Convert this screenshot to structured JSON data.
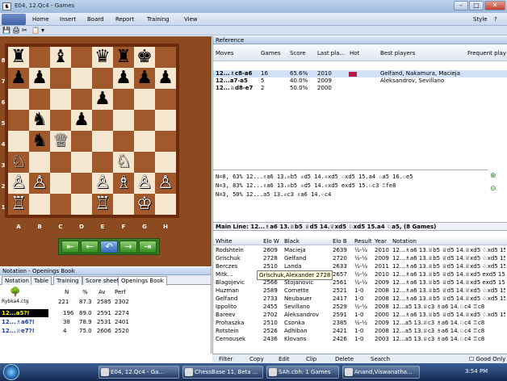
{
  "window": {
    "title": "E04, 12.Qc4 - Games",
    "controls": [
      "–",
      "□",
      "✕"
    ]
  },
  "menu": {
    "items": [
      "Home",
      "Insert",
      "Board",
      "Report",
      "Training",
      "View"
    ],
    "style": "Style"
  },
  "quick_access": [
    "💾",
    "🖨",
    "✂",
    "📋",
    "▾"
  ],
  "board": {
    "ranks": [
      "8",
      "7",
      "6",
      "5",
      "4",
      "3",
      "2",
      "1"
    ],
    "files": [
      "A",
      "B",
      "C",
      "D",
      "E",
      "F",
      "G",
      "H"
    ],
    "position": [
      [
        "♜",
        "",
        "♝",
        "",
        "♛",
        "♜",
        "♚",
        ""
      ],
      [
        "♟",
        "♟",
        "",
        "",
        "",
        "♟",
        "♟",
        "♟"
      ],
      [
        "",
        "",
        "",
        "",
        "♟",
        "",
        "",
        ""
      ],
      [
        "",
        "♞",
        "",
        "♟",
        "",
        "",
        "",
        ""
      ],
      [
        "",
        "♞",
        "♕",
        "",
        "",
        "",
        "",
        ""
      ],
      [
        "♘",
        "",
        "",
        "",
        "",
        "♘",
        "",
        ""
      ],
      [
        "♙",
        "♙",
        "",
        "",
        "♙",
        "♗",
        "♙",
        "♙"
      ],
      [
        "♖",
        "",
        "",
        "",
        "♖",
        "",
        "♔",
        ""
      ]
    ],
    "white_pieces": [
      "♔",
      "♕",
      "♖",
      "♗",
      "♘",
      "♙"
    ],
    "nav": [
      "⇤",
      "←",
      "↶",
      "→",
      "⇥"
    ]
  },
  "notation": {
    "header": "Notation - Openings Book",
    "tabs": [
      "Notation",
      "Table",
      "Training",
      "Score sheet",
      "Openings Book"
    ],
    "book_name": "Rybka4.ctg",
    "cols": [
      "N",
      "%",
      "Av",
      "Perf"
    ],
    "summary": [
      "221",
      "87.3",
      "2585",
      "2302"
    ],
    "moves": [
      {
        "move": "12...a5?!",
        "n": "196",
        "pct": "89.0",
        "av": "2591",
        "perf": "2274"
      },
      {
        "move": "12...♗a6?!",
        "n": "38",
        "pct": "78.9",
        "av": "2531",
        "perf": "2401"
      },
      {
        "move": "12...♕e7?!",
        "n": "4",
        "pct": "75.0",
        "av": "2606",
        "perf": "2520"
      }
    ]
  },
  "reference": {
    "header": "Reference",
    "cols": [
      "Moves",
      "Games",
      "Score",
      "Last pla...",
      "Hot",
      "Best players",
      "Frequent play"
    ],
    "rows": [
      {
        "move": "12...♗c8-a6",
        "games": "16",
        "score": "65.6%",
        "last": "2010",
        "best": "Gelfand, Nakamura, Macieja"
      },
      {
        "move": "12...a7-a5",
        "games": "5",
        "score": "40.0%",
        "last": "2009",
        "best": "Aleksandrov, Sevillano"
      },
      {
        "move": "12...♕d8-e7",
        "games": "2",
        "score": "50.0%",
        "last": "2000",
        "best": ""
      }
    ]
  },
  "engine": {
    "lines": [
      "N=8, 63%  12...♗a6 13.♕b5 ♕d5 14.♕xd5 ♘xd5 15.a4 ♘a5 16.♘e5",
      "N=3, 83%  12...♗a6 13.♕b5 ♕d5 14.♕xd5 exd5 15.♘c3 ♖fe8",
      "N=3, 50%  12...a5 13.♕c3 ♗a6 14.♘c4"
    ],
    "mainline": "Main Line: 12...♗a6 13.♕b5 ♕d5 14.♕xd5 ♘xd5 15.a4 ♘a5, (8 Games)"
  },
  "games": {
    "cols": [
      "White",
      "Elo W",
      "Black",
      "Elo B",
      "Result",
      "Year",
      "Notation"
    ],
    "rows": [
      [
        "Rodshtein",
        "2609",
        "Macieja",
        "2639",
        "½-½",
        "2010",
        "12...♗a6 13.♕b5 ♕d5 14.♕xd5 ♘xd5 15.a4 ♘a5"
      ],
      [
        "Grischuk",
        "2728",
        "Gelfand",
        "2720",
        "½-½",
        "2009",
        "12...♗a6 13.♕b5 ♕d5 14.♕xd5 ♘xd5 15.a4 ♘a5"
      ],
      [
        "Berczes",
        "2510",
        "Landa",
        "2633",
        "½-½",
        "2011",
        "12...♗a6 13.♕b5 ♕d5 14.♕xd5 ♘xd5 15.a4 ♘a5"
      ],
      [
        "Mitk...",
        "",
        "...amura",
        "2657",
        "½-½",
        "2010",
        "12...♗a6 13.♕b5 ♕d5 14.♕xd5 exd5 15.♘c3 ♖fe8"
      ],
      [
        "Blagojevic",
        "2566",
        "Stojanovic",
        "2561",
        "½-½",
        "2009",
        "12...♗a6 13.♕b5 ♕d5 14.♕xd5 exd5 15.♘c3 ♖fe8"
      ],
      [
        "Huzman",
        "2589",
        "Cornette",
        "2521",
        "1-0",
        "2008",
        "12...♗a6 13.♕b5 ♕d5 14.♕xd5 ♘xd5 15.a4 ♘a5"
      ],
      [
        "Gelfand",
        "2733",
        "Neubauer",
        "2417",
        "1-0",
        "2008",
        "12...♗a6 13.♕b5 ♕d5 14.♕xd5 ♘xd5 15.a4 ♘a5"
      ],
      [
        "Ippolito",
        "2455",
        "Sevillano",
        "2529",
        "½-½",
        "2008",
        "12...a5 13.♕c3 ♗a6 14.♘c4 ♖c8"
      ],
      [
        "Bareev",
        "2702",
        "Aleksandrov",
        "2591",
        "1-0",
        "2000",
        "12...♗a6 13.♕b5 ♕d5 14.♕xd5 ♘xd5 15.a4 ♘a5"
      ],
      [
        "Prohaszka",
        "2510",
        "Csonka",
        "2385",
        "½-½",
        "2009",
        "12...a5 13.♕c3 ♗a6 14.♘c4 ♖c8"
      ],
      [
        "Rotstein",
        "2526",
        "Adhiban",
        "2421",
        "1-0",
        "2008",
        "12...a5 13.♕c3 ♗a6 14.♘c4 ♖c8"
      ],
      [
        "Cernousek",
        "2436",
        "Klovans",
        "2426",
        "1-0",
        "2003",
        "12...a5 13.♕c3 ♗a6 14.♘c4 ♖c8"
      ]
    ],
    "tooltip": "Grischuk,Alexander 2728"
  },
  "bottom": {
    "items": [
      "Filter",
      "Copy",
      "Edit",
      "Clip",
      "Delete",
      "Search"
    ],
    "good_only": "Good Only"
  },
  "taskbar": {
    "items": [
      "E04, 12.Qc4 - Ga...",
      "ChessBase 11, Beta ...",
      "SAh.cbh: 1 Games",
      "Anand,Viswanatha..."
    ],
    "clock": "3:54 PM"
  }
}
